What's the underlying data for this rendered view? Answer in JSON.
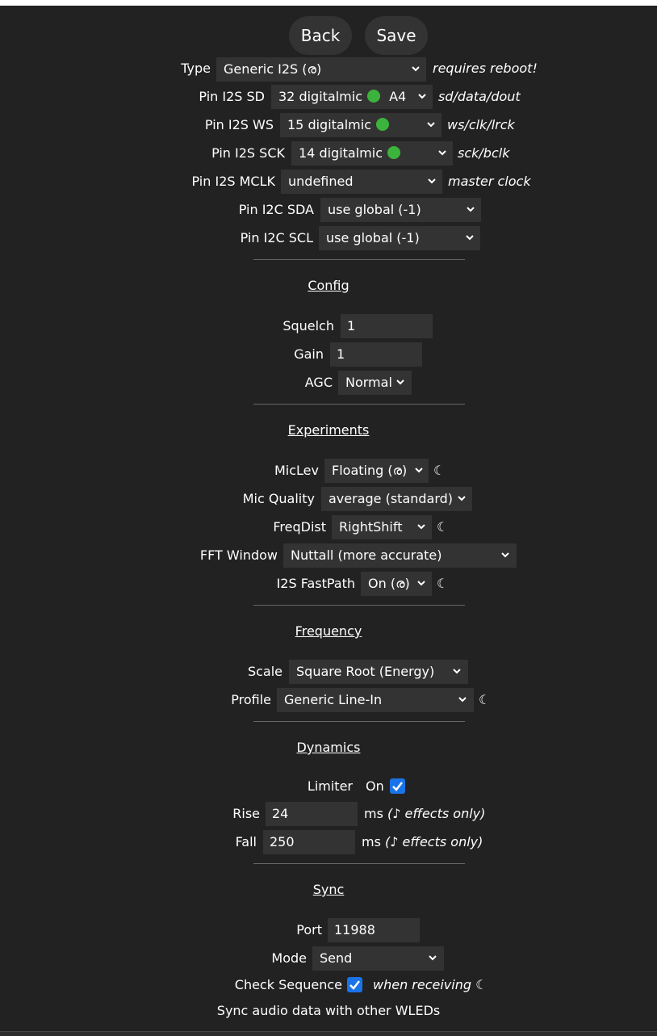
{
  "buttons": {
    "back": "Back",
    "save": "Save"
  },
  "pins": {
    "type_label": "Type",
    "type_value": "Generic I2S (ര)",
    "type_note": "requires reboot!",
    "sd_label": "Pin I2S SD",
    "sd_value": "32 digitalmic",
    "sd_extra": "A4",
    "sd_note": "sd/data/dout",
    "ws_label": "Pin I2S WS",
    "ws_value": "15 digitalmic",
    "ws_note": "ws/clk/lrck",
    "sck_label": "Pin I2S SCK",
    "sck_value": "14 digitalmic",
    "sck_note": "sck/bclk",
    "mclk_label": "Pin I2S MCLK",
    "mclk_value": "undefined",
    "mclk_note": "master clock",
    "sda_label": "Pin I2C SDA",
    "sda_value": "use global (-1)",
    "scl_label": "Pin I2C SCL",
    "scl_value": "use global (-1)"
  },
  "config": {
    "title": "Config",
    "squelch_label": "Squelch",
    "squelch_value": "1",
    "gain_label": "Gain",
    "gain_value": "1",
    "agc_label": "AGC",
    "agc_value": "Normal"
  },
  "experiments": {
    "title": "Experiments",
    "miclev_label": "MicLev",
    "miclev_value": "Floating (ര)",
    "micq_label": "Mic Quality",
    "micq_value": "average (standard)",
    "freqdist_label": "FreqDist",
    "freqdist_value": "RightShift",
    "fft_label": "FFT Window",
    "fft_value": "Nuttall (more accurate)",
    "fastpath_label": "I2S FastPath",
    "fastpath_value": "On (ര)",
    "moon": "☾"
  },
  "frequency": {
    "title": "Frequency",
    "scale_label": "Scale",
    "scale_value": "Square Root (Energy)",
    "profile_label": "Profile",
    "profile_value": "Generic Line-In"
  },
  "dynamics": {
    "title": "Dynamics",
    "limiter_label": "Limiter",
    "limiter_on": "On",
    "limiter_checked": true,
    "rise_label": "Rise",
    "rise_value": "24",
    "fall_label": "Fall",
    "fall_value": "250",
    "ms": "ms",
    "effects_note": "(♪ effects only)"
  },
  "sync": {
    "title": "Sync",
    "port_label": "Port",
    "port_value": "11988",
    "mode_label": "Mode",
    "mode_value": "Send",
    "checkseq_label": "Check Sequence",
    "checkseq_checked": true,
    "checkseq_note": "when receiving ☾",
    "footer": "Sync audio data with other WLEDs"
  },
  "colors": {
    "background": "#222222",
    "control": "#333333",
    "accent": "#1a73e8",
    "pin_ok": "#3cb33c"
  }
}
